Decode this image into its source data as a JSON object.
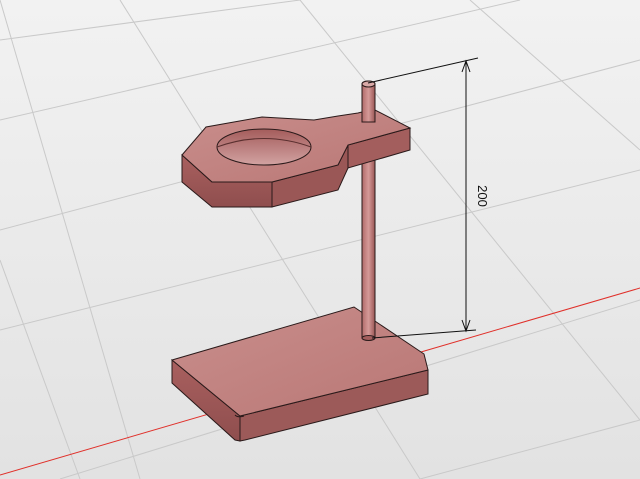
{
  "viewport": {
    "background": "#e9e9e9",
    "grid_color": "#c8c8c8",
    "axis_color": "#e0302a"
  },
  "model": {
    "material_color": "#c58a88",
    "edge_color": "#2a1a1a",
    "parts": [
      "base-plate",
      "vertical-rod",
      "ring-clamp"
    ]
  },
  "dimension": {
    "value": "200"
  }
}
